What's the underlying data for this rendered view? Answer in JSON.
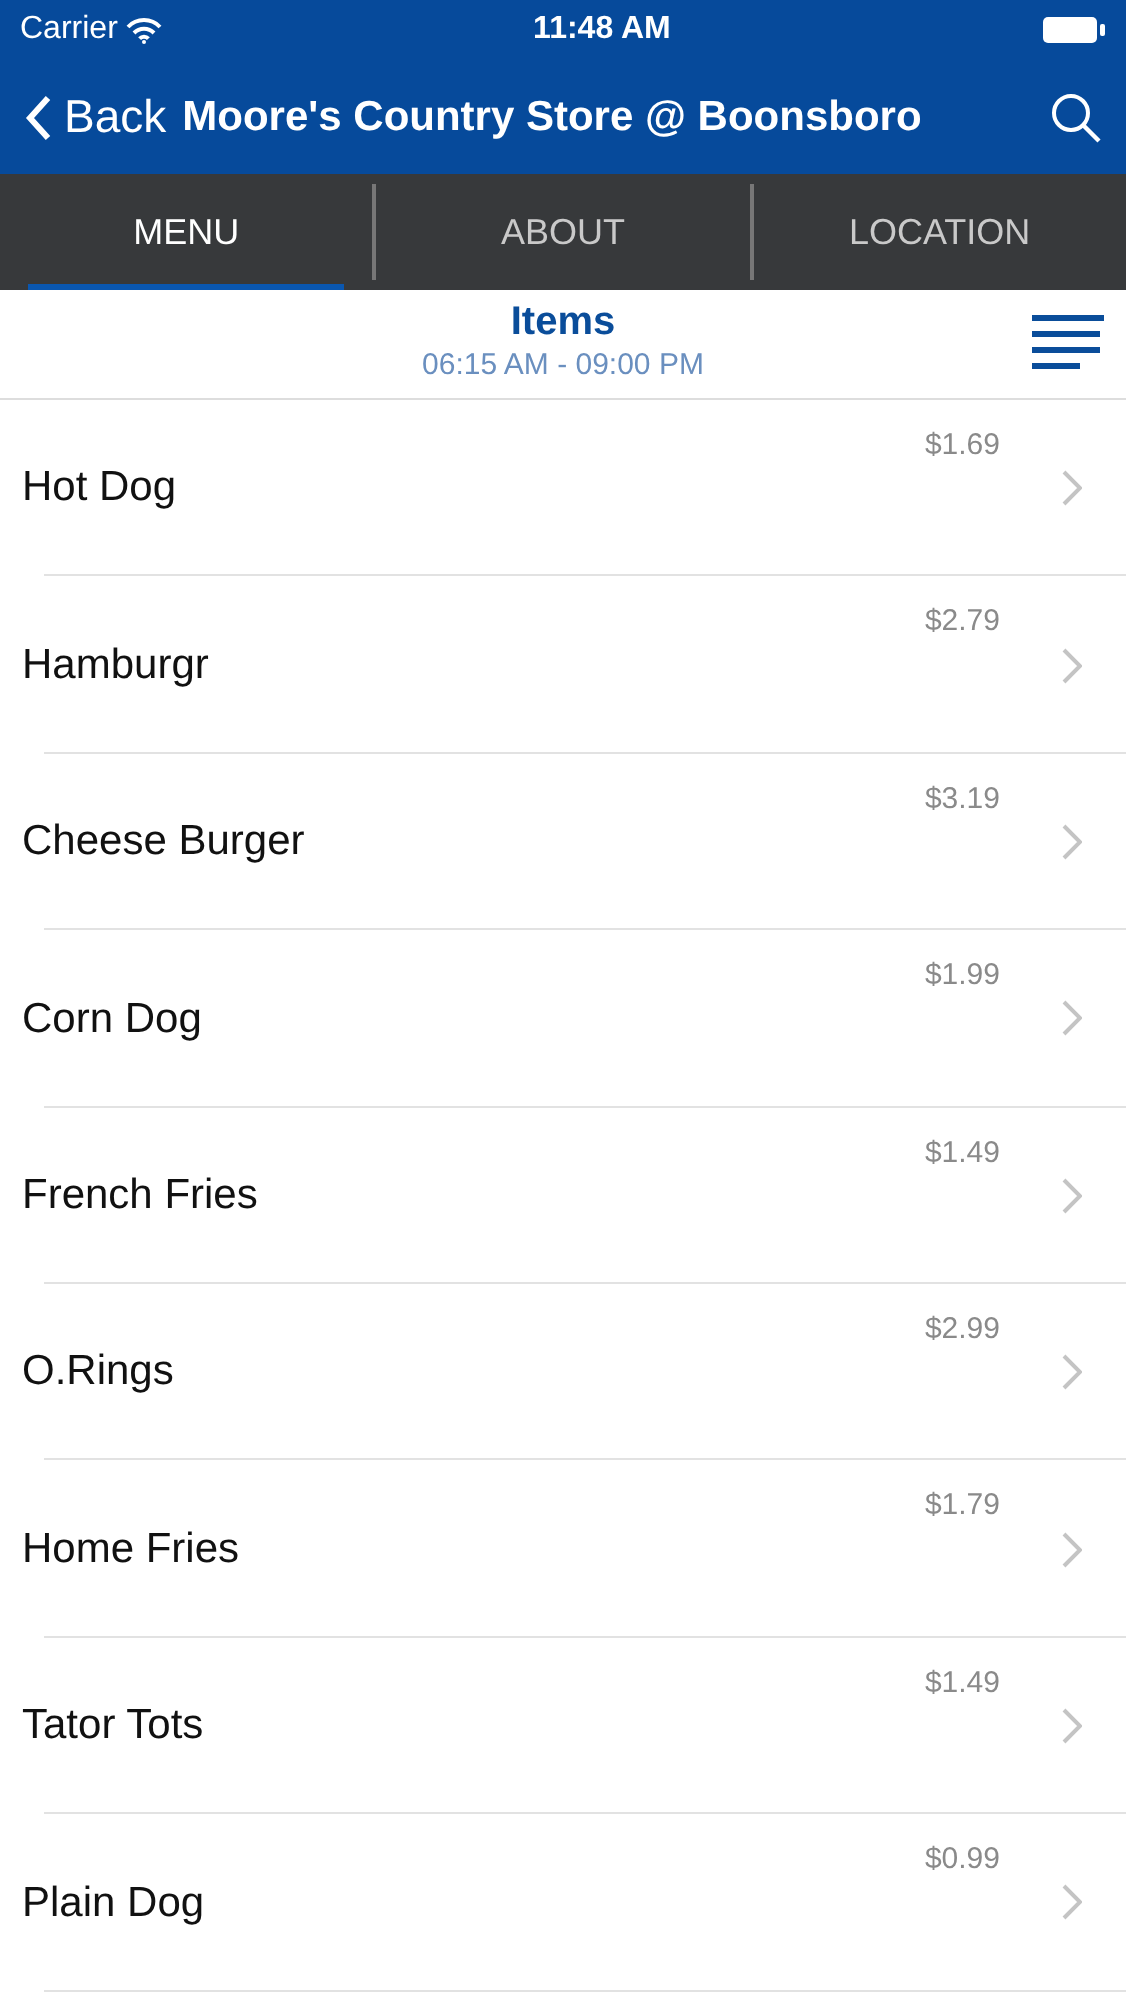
{
  "status_bar": {
    "carrier": "Carrier",
    "time": "11:48 AM"
  },
  "nav_bar": {
    "back": "Back",
    "title": "Moore's Country Store @ Boonsboro"
  },
  "tabs": [
    {
      "label": "MENU",
      "selected": true
    },
    {
      "label": "ABOUT",
      "selected": false
    },
    {
      "label": "LOCATION",
      "selected": false
    }
  ],
  "section": {
    "title": "Items",
    "hours": "06:15 AM - 09:00 PM"
  },
  "items": [
    {
      "name": "Hot Dog",
      "price": "$1.69"
    },
    {
      "name": "Hamburgr",
      "price": "$2.79"
    },
    {
      "name": "Cheese Burger",
      "price": "$3.19"
    },
    {
      "name": "Corn Dog",
      "price": "$1.99"
    },
    {
      "name": "French Fries",
      "price": "$1.49"
    },
    {
      "name": "O.Rings",
      "price": "$2.99"
    },
    {
      "name": "Home Fries",
      "price": "$1.79"
    },
    {
      "name": "Tator Tots",
      "price": "$1.49"
    },
    {
      "name": "Plain Dog",
      "price": "$0.99"
    }
  ]
}
